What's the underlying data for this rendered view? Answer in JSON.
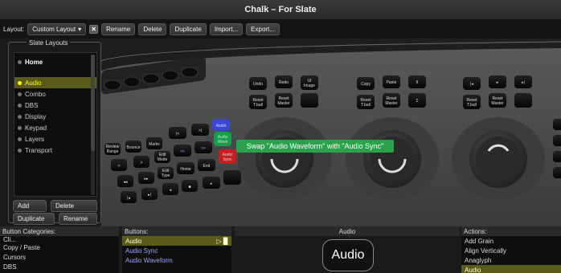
{
  "window": {
    "title": "Chalk – For Slate"
  },
  "toolbar": {
    "layout_label": "Layout:",
    "layout_value": "Custom Layout",
    "buttons": [
      "Rename",
      "Delete",
      "Duplicate",
      "Import...",
      "Export..."
    ]
  },
  "slate_layouts": {
    "legend": "Slate Layouts",
    "items": [
      "Home",
      "Audio",
      "Combo",
      "DBS",
      "Display",
      "Keypad",
      "Layers",
      "Transport"
    ],
    "selected": "Audio",
    "buttons": {
      "add": "Add",
      "delete": "Delete",
      "duplicate": "Duplicate",
      "rename": "Rename"
    }
  },
  "console": {
    "tooltip": "Swap \"Audio Waveform\" with \"Audio Sync\"",
    "left_keys": [
      "Review Range",
      "Bounce",
      "Marks",
      "|<",
      ">|",
      "Audio",
      "<",
      ">",
      "Edit Mode",
      "<<",
      ">>",
      "Audio Wave",
      "Edit Type",
      "Home",
      "End",
      "Audio Sync"
    ],
    "panel1": [
      "Undo",
      "Redo",
      "UI Image",
      "Reset T.ball",
      "Reset Master"
    ],
    "panel2": [
      "Copy",
      "Paste",
      "Reset T.ball",
      "Reset Master"
    ],
    "panel3": [
      "Reset T.ball",
      "Reset Master"
    ]
  },
  "bottom": {
    "categories_header": "Button Categories:",
    "categories": [
      "Cli...",
      "Copy / Paste",
      "Cursors",
      "DBS"
    ],
    "buttons_header": "Buttons:",
    "buttons": [
      "Audio",
      "Audio Sync",
      "Audio Waveform"
    ],
    "buttons_selected": "Audio",
    "preview_header": "Audio",
    "preview_label": "Audio",
    "actions_header": "Actions:",
    "actions": [
      "Add Grain",
      "Align Vertically",
      "Anaglyph",
      "Audio"
    ]
  }
}
